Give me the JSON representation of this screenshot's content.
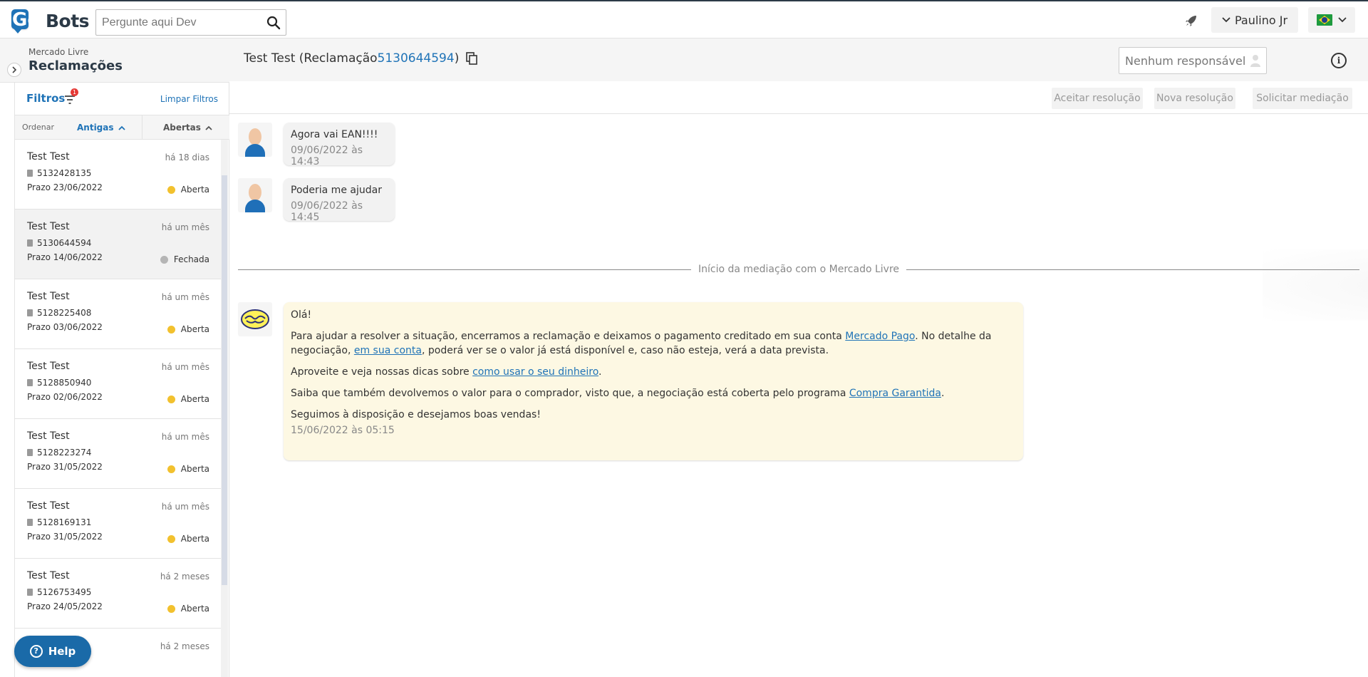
{
  "app": {
    "logo_go": "Go",
    "logo_bots": "Bots",
    "search_placeholder": "Pergunte aqui Dev",
    "user_name": "Paulino Jr"
  },
  "sidebar": {
    "marketplace": "Mercado Livre",
    "title": "Reclamações",
    "filters_label": "Filtros",
    "filters_badge": "1",
    "clear_filters": "Limpar Filtros",
    "sort_label": "Ordenar",
    "sort_value": "Antigas",
    "status_filter": "Abertas",
    "items": [
      {
        "title": "Test Test",
        "age": "há 18 dias",
        "number": "5132428135",
        "prazo": "Prazo 23/06/2022",
        "status": "Aberta",
        "state": "open"
      },
      {
        "title": "Test Test",
        "age": "há um mês",
        "number": "5130644594",
        "prazo": "Prazo 14/06/2022",
        "status": "Fechada",
        "state": "closed"
      },
      {
        "title": "Test Test",
        "age": "há um mês",
        "number": "5128225408",
        "prazo": "Prazo 03/06/2022",
        "status": "Aberta",
        "state": "open"
      },
      {
        "title": "Test Test",
        "age": "há um mês",
        "number": "5128850940",
        "prazo": "Prazo 02/06/2022",
        "status": "Aberta",
        "state": "open"
      },
      {
        "title": "Test Test",
        "age": "há um mês",
        "number": "5128223274",
        "prazo": "Prazo 31/05/2022",
        "status": "Aberta",
        "state": "open"
      },
      {
        "title": "Test Test",
        "age": "há um mês",
        "number": "5128169131",
        "prazo": "Prazo 31/05/2022",
        "status": "Aberta",
        "state": "open"
      },
      {
        "title": "Test Test",
        "age": "há 2 meses",
        "number": "5126753495",
        "prazo": "Prazo 24/05/2022",
        "status": "Aberta",
        "state": "open"
      },
      {
        "title": "",
        "age": "há 2 meses",
        "number": "",
        "prazo": "",
        "status": "",
        "state": ""
      }
    ],
    "help_label": "Help"
  },
  "main": {
    "title_prefix": "Test Test (Reclamação ",
    "claim_id": "5130644594",
    "title_suffix": ")",
    "responsible_placeholder": "Nenhum responsável",
    "actions": [
      "Aceitar resolução",
      "Nova resolução",
      "Solicitar mediação"
    ],
    "messages": [
      {
        "text": "Agora vai EAN!!!!",
        "time": "09/06/2022 às 14:43"
      },
      {
        "text": "Poderia me ajudar",
        "time": "09/06/2022 às 14:45"
      }
    ],
    "divider": "Início da mediação com o Mercado Livre",
    "ml_message": {
      "greeting": "Olá!",
      "p1_a": "Para ajudar a resolver a situação, encerramos a reclamação e deixamos o pagamento creditado em sua conta ",
      "p1_link1": "Mercado Pago",
      "p1_b": ". No detalhe da negociação, ",
      "p1_link2": "em sua conta",
      "p1_c": ", poderá ver se o valor já está disponível e, caso não esteja, verá a data prevista.",
      "p2_a": "Aproveite e veja nossas dicas sobre ",
      "p2_link": "como usar o seu dinheiro",
      "p2_b": ".",
      "p3_a": "Saiba que também devolvemos o valor para o comprador, visto que, a negociação está coberta pelo programa ",
      "p3_link": "Compra Garantida",
      "p3_b": ".",
      "p4": "Seguimos à disposição e desejamos boas vendas!",
      "time": "15/06/2022 às 05:15"
    }
  },
  "colors": {
    "accent": "#1f73b7",
    "open": "#f2c12e",
    "closed": "#b5b5b5",
    "ml_bubble": "#fdf8e3"
  }
}
